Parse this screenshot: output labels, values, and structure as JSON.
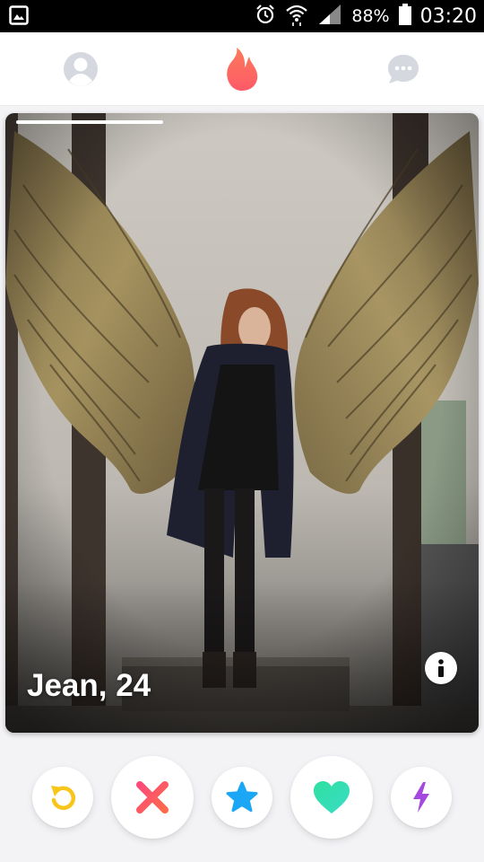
{
  "status_bar": {
    "battery_percent": "88%",
    "time": "03:20",
    "icons": [
      "image-notification-icon",
      "alarm-icon",
      "wifi-icon",
      "signal-icon",
      "battery-icon"
    ]
  },
  "top_nav": {
    "items": [
      {
        "name": "profile",
        "icon": "profile-icon"
      },
      {
        "name": "discover",
        "icon": "flame-icon",
        "active": true
      },
      {
        "name": "messages",
        "icon": "chat-icon"
      }
    ],
    "colors": {
      "flame": "#fd5f5d",
      "inactive": "#d5d8de"
    }
  },
  "card": {
    "name_age": "Jean, 24",
    "photo_progress": 1,
    "photo_description_icon": "info-icon"
  },
  "actions": {
    "buttons": [
      {
        "name": "rewind",
        "icon": "rewind-icon",
        "color": "#f8c61b"
      },
      {
        "name": "nope",
        "icon": "close-icon",
        "color": "#fe4f6e"
      },
      {
        "name": "super-like",
        "icon": "star-icon",
        "color": "#1ca6f6"
      },
      {
        "name": "like",
        "icon": "heart-icon",
        "color": "#32dfb1"
      },
      {
        "name": "boost",
        "icon": "lightning-icon",
        "color": "#a448e0"
      }
    ]
  }
}
